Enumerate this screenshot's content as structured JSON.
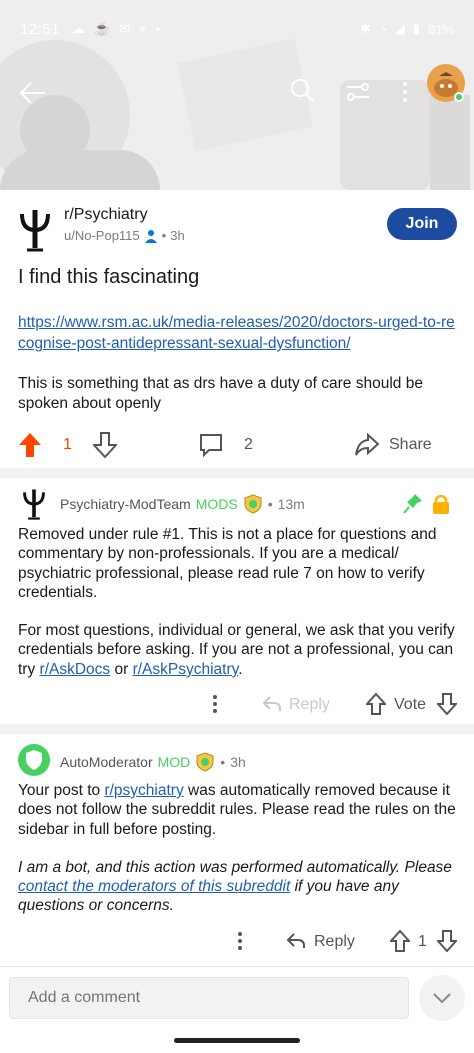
{
  "status_bar": {
    "time": "12:51",
    "battery": "81%"
  },
  "subreddit": {
    "name": "r/Psychiatry",
    "user": "u/No-Pop115",
    "time": "3h",
    "join_label": "Join"
  },
  "post": {
    "title": "I find this fascinating",
    "link": "https://www.rsm.ac.uk/media-releases/2020/doctors-urged-to-recognise-post-antidepressant-sexual-dysfunction/",
    "body": "This is something that as drs have a duty of care should be spoken about openly",
    "votes": "1",
    "comments": "2",
    "share_label": "Share"
  },
  "comments": [
    {
      "author": "Psychiatry-ModTeam",
      "flair": "MODS",
      "time": "13m",
      "para1": "Removed under rule #1. This is not a place for questions and commentary by non-professionals. If you are a medical/ psychiatric professional, please read rule 7 on how to verify credentials.",
      "para2_pre": "For most questions, individual or general, we ask that you verify credentials before asking. If you are not a professional, you can try ",
      "link1": "r/AskDocs",
      "mid": " or ",
      "link2": "r/AskPsychiatry",
      "end": ".",
      "reply_label": "Reply",
      "vote_label": "Vote"
    },
    {
      "author": "AutoModerator",
      "flair": "MOD",
      "time": "3h",
      "p1_pre": "Your post to ",
      "p1_link": "r/psychiatry",
      "p1_post": " was automatically removed because it does not follow the subreddit rules. Please read the rules on the sidebar in full before posting.",
      "p2_pre": "I am a bot, and this action was performed automatically. Please ",
      "p2_link": "contact the moderators of this subreddit",
      "p2_post": " if you have any questions or concerns.",
      "reply_label": "Reply",
      "votes": "1"
    }
  ],
  "composer": {
    "placeholder": "Add a comment"
  },
  "colors": {
    "upvote": "#ff4500",
    "join": "#1d4ba0",
    "mod_green": "#46d160",
    "link": "#1f5fb0"
  }
}
